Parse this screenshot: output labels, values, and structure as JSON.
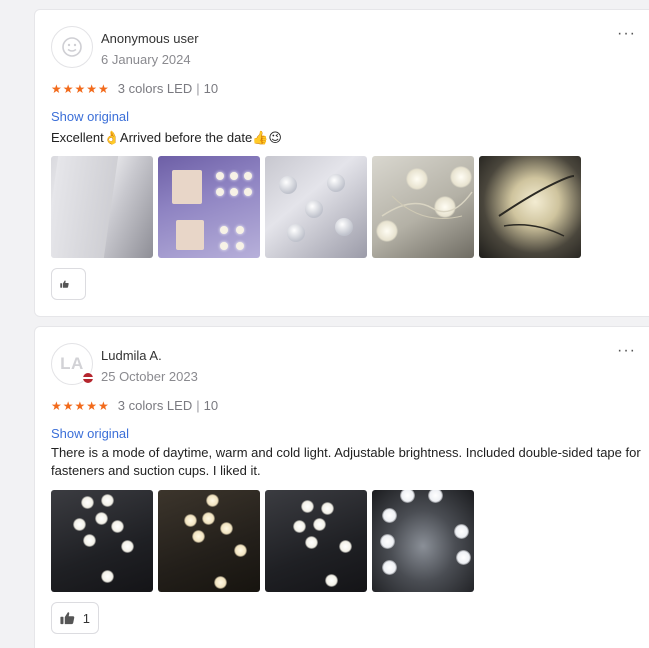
{
  "reviews": [
    {
      "user_name": "Anonymous user",
      "date": "6 January 2024",
      "stars": "★★★★★",
      "variant": "3 colors LED",
      "separator": "|",
      "quantity": "10",
      "show_original": "Show original",
      "text": "Excellent👌Arrived before the date👍😉",
      "more_label": "···",
      "like_count": "",
      "photo_count": 5
    },
    {
      "user_name": "Ludmila A.",
      "avatar_initials": "LA",
      "date": "25 October 2023",
      "stars": "★★★★★",
      "variant": "3 colors LED",
      "separator": "|",
      "quantity": "10",
      "show_original": "Show original",
      "text": "There is a mode of daytime, warm and cold light. Adjustable brightness. Included double-sided tape for fasteners and suction cups. I liked it.",
      "more_label": "···",
      "like_count": "1",
      "photo_count": 4
    }
  ],
  "colors": {
    "star": "#f26a1b",
    "link": "#3b6fd8",
    "muted_text": "#8a8a8f"
  },
  "icons": {
    "avatar_placeholder": "smiley-avatar-icon",
    "flag": "latvia-flag-icon",
    "like": "thumbs-up-icon",
    "more": "more-options-icon"
  }
}
